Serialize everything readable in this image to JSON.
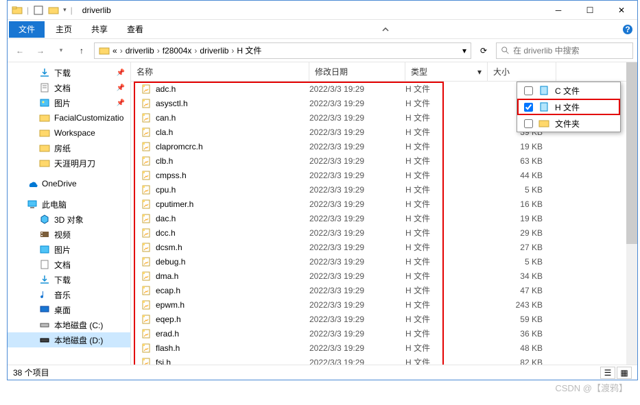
{
  "titlebar": {
    "title": "driverlib"
  },
  "menu": {
    "file": "文件",
    "home": "主页",
    "share": "共享",
    "view": "查看"
  },
  "breadcrumb": {
    "parts": [
      "«",
      "driverlib",
      "f28004x",
      "driverlib",
      "H 文件"
    ]
  },
  "search": {
    "placeholder": "在 driverlib 中搜索"
  },
  "columns": {
    "name": "名称",
    "date": "修改日期",
    "type": "类型",
    "size": "大小"
  },
  "sidebar": {
    "downloads": "下载",
    "documents": "文档",
    "pictures": "图片",
    "fc": "FacialCustomizatio",
    "ws": "Workspace",
    "fz": "房纸",
    "ty": "天涯明月刀",
    "onedrive": "OneDrive",
    "thispc": "此电脑",
    "obj3d": "3D 对象",
    "videos": "视频",
    "pictures2": "图片",
    "documents2": "文档",
    "downloads2": "下载",
    "music": "音乐",
    "desktop": "桌面",
    "diskc": "本地磁盘 (C:)",
    "diskd": "本地磁盘 (D:)"
  },
  "files": [
    {
      "name": "adc.h",
      "date": "2022/3/3 19:29",
      "type": "H 文件",
      "size": ""
    },
    {
      "name": "asysctl.h",
      "date": "2022/3/3 19:29",
      "type": "H 文件",
      "size": ""
    },
    {
      "name": "can.h",
      "date": "2022/3/3 19:29",
      "type": "H 文件",
      "size": ""
    },
    {
      "name": "cla.h",
      "date": "2022/3/3 19:29",
      "type": "H 文件",
      "size": "39 KB"
    },
    {
      "name": "clapromcrc.h",
      "date": "2022/3/3 19:29",
      "type": "H 文件",
      "size": "19 KB"
    },
    {
      "name": "clb.h",
      "date": "2022/3/3 19:29",
      "type": "H 文件",
      "size": "63 KB"
    },
    {
      "name": "cmpss.h",
      "date": "2022/3/3 19:29",
      "type": "H 文件",
      "size": "44 KB"
    },
    {
      "name": "cpu.h",
      "date": "2022/3/3 19:29",
      "type": "H 文件",
      "size": "5 KB"
    },
    {
      "name": "cputimer.h",
      "date": "2022/3/3 19:29",
      "type": "H 文件",
      "size": "16 KB"
    },
    {
      "name": "dac.h",
      "date": "2022/3/3 19:29",
      "type": "H 文件",
      "size": "19 KB"
    },
    {
      "name": "dcc.h",
      "date": "2022/3/3 19:29",
      "type": "H 文件",
      "size": "29 KB"
    },
    {
      "name": "dcsm.h",
      "date": "2022/3/3 19:29",
      "type": "H 文件",
      "size": "27 KB"
    },
    {
      "name": "debug.h",
      "date": "2022/3/3 19:29",
      "type": "H 文件",
      "size": "5 KB"
    },
    {
      "name": "dma.h",
      "date": "2022/3/3 19:29",
      "type": "H 文件",
      "size": "34 KB"
    },
    {
      "name": "ecap.h",
      "date": "2022/3/3 19:29",
      "type": "H 文件",
      "size": "47 KB"
    },
    {
      "name": "epwm.h",
      "date": "2022/3/3 19:29",
      "type": "H 文件",
      "size": "243 KB"
    },
    {
      "name": "eqep.h",
      "date": "2022/3/3 19:29",
      "type": "H 文件",
      "size": "59 KB"
    },
    {
      "name": "erad.h",
      "date": "2022/3/3 19:29",
      "type": "H 文件",
      "size": "36 KB"
    },
    {
      "name": "flash.h",
      "date": "2022/3/3 19:29",
      "type": "H 文件",
      "size": "48 KB"
    },
    {
      "name": "fsi.h",
      "date": "2022/3/3 19:29",
      "type": "H 文件",
      "size": "82 KB"
    }
  ],
  "filter": {
    "c_file": "C 文件",
    "h_file": "H 文件",
    "folder": "文件夹"
  },
  "status": {
    "count": "38 个项目"
  },
  "watermark": "CSDN @【渡鸦】"
}
